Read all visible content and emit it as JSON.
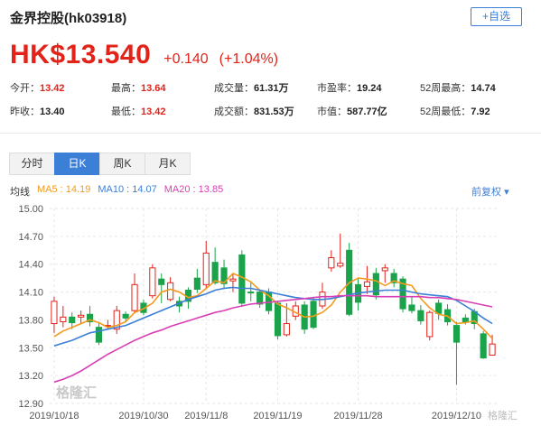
{
  "header": {
    "title": "金界控股(hk03918)",
    "add_button": "+自选"
  },
  "quote": {
    "price": "HK$13.540",
    "change": "+0.140",
    "change_pct": "(+1.04%)",
    "color": "#e2231a"
  },
  "stats": [
    {
      "label": "今开：",
      "value": "13.42",
      "tone": "red"
    },
    {
      "label": "最高：",
      "value": "13.64",
      "tone": "red"
    },
    {
      "label": "成交量：",
      "value": "61.31万",
      "tone": "plain"
    },
    {
      "label": "市盈率：",
      "value": "19.24",
      "tone": "plain"
    },
    {
      "label": "52周最高：",
      "value": "14.74",
      "tone": "plain"
    },
    {
      "label": "昨收：",
      "value": "13.40",
      "tone": "plain"
    },
    {
      "label": "最低：",
      "value": "13.42",
      "tone": "red"
    },
    {
      "label": "成交额：",
      "value": "831.53万",
      "tone": "plain"
    },
    {
      "label": "市值：",
      "value": "587.77亿",
      "tone": "plain"
    },
    {
      "label": "52周最低：",
      "value": "7.92",
      "tone": "plain"
    }
  ],
  "tabs": {
    "minute": "分时",
    "day": "日K",
    "week": "周K",
    "month": "月K",
    "active": "day"
  },
  "legend": {
    "label": "均线",
    "ma5": "MA5 : 14.19",
    "ma10": "MA10 : 14.07",
    "ma20": "MA20 : 13.85",
    "adjust": "前复权"
  },
  "colors": {
    "up": "#e2231a",
    "down": "#1aa34a",
    "accent": "#3c7fd6",
    "ma5": "#f39a1e",
    "ma10": "#3c7fd6",
    "ma20": "#d93fb5"
  },
  "watermark": {
    "main": "格隆汇",
    "corner": "格隆汇"
  },
  "chart_data": {
    "type": "candlestick",
    "ylim": [
      12.9,
      15.0
    ],
    "y_ticks": [
      "15.00",
      "14.70",
      "14.40",
      "14.10",
      "13.80",
      "13.50",
      "13.20",
      "12.90"
    ],
    "x_tick_labels": [
      "2019/10/18",
      "2019/10/30",
      "2019/11/8",
      "2019/11/19",
      "2019/11/28",
      "2019/12/10"
    ],
    "candles": [
      {
        "o": 13.76,
        "c": 14.0,
        "h": 14.05,
        "l": 13.66
      },
      {
        "o": 13.78,
        "c": 13.83,
        "h": 13.95,
        "l": 13.72
      },
      {
        "o": 13.83,
        "c": 13.77,
        "h": 13.88,
        "l": 13.7
      },
      {
        "o": 13.83,
        "c": 13.85,
        "h": 13.9,
        "l": 13.75
      },
      {
        "o": 13.86,
        "c": 13.78,
        "h": 13.95,
        "l": 13.73
      },
      {
        "o": 13.72,
        "c": 13.56,
        "h": 13.78,
        "l": 13.53
      },
      {
        "o": 13.73,
        "c": 13.74,
        "h": 13.8,
        "l": 13.7
      },
      {
        "o": 13.7,
        "c": 13.9,
        "h": 13.95,
        "l": 13.65
      },
      {
        "o": 13.86,
        "c": 13.82,
        "h": 13.89,
        "l": 13.78
      },
      {
        "o": 13.9,
        "c": 14.18,
        "h": 14.3,
        "l": 13.87
      },
      {
        "o": 13.98,
        "c": 13.88,
        "h": 14.02,
        "l": 13.85
      },
      {
        "o": 14.06,
        "c": 14.36,
        "h": 14.4,
        "l": 14.03
      },
      {
        "o": 14.24,
        "c": 14.18,
        "h": 14.3,
        "l": 13.98
      },
      {
        "o": 14.02,
        "c": 14.2,
        "h": 14.26,
        "l": 14.0
      },
      {
        "o": 14.0,
        "c": 13.95,
        "h": 14.05,
        "l": 13.88
      },
      {
        "o": 14.12,
        "c": 14.0,
        "h": 14.15,
        "l": 13.92
      },
      {
        "o": 14.25,
        "c": 14.13,
        "h": 14.35,
        "l": 14.09
      },
      {
        "o": 14.18,
        "c": 14.52,
        "h": 14.65,
        "l": 14.13
      },
      {
        "o": 14.42,
        "c": 14.2,
        "h": 14.58,
        "l": 14.18
      },
      {
        "o": 14.36,
        "c": 14.19,
        "h": 14.45,
        "l": 14.13
      },
      {
        "o": 14.22,
        "c": 14.24,
        "h": 14.3,
        "l": 14.1
      },
      {
        "o": 14.5,
        "c": 13.98,
        "h": 14.55,
        "l": 13.94
      },
      {
        "o": 14.1,
        "c": 14.09,
        "h": 14.2,
        "l": 14.0
      },
      {
        "o": 14.1,
        "c": 13.97,
        "h": 14.12,
        "l": 13.93
      },
      {
        "o": 14.1,
        "c": 13.9,
        "h": 14.14,
        "l": 13.86
      },
      {
        "o": 13.98,
        "c": 13.63,
        "h": 14.0,
        "l": 13.59
      },
      {
        "o": 13.64,
        "c": 13.76,
        "h": 13.98,
        "l": 13.62
      },
      {
        "o": 13.84,
        "c": 13.95,
        "h": 14.0,
        "l": 13.8
      },
      {
        "o": 13.96,
        "c": 13.7,
        "h": 14.0,
        "l": 13.65
      },
      {
        "o": 14.0,
        "c": 13.72,
        "h": 14.05,
        "l": 13.7
      },
      {
        "o": 13.95,
        "c": 14.1,
        "h": 14.2,
        "l": 13.92
      },
      {
        "o": 14.36,
        "c": 14.47,
        "h": 14.55,
        "l": 14.32
      },
      {
        "o": 14.38,
        "c": 14.41,
        "h": 14.73,
        "l": 14.36
      },
      {
        "o": 14.55,
        "c": 13.86,
        "h": 14.63,
        "l": 13.84
      },
      {
        "o": 14.18,
        "c": 13.99,
        "h": 14.25,
        "l": 13.9
      },
      {
        "o": 14.16,
        "c": 14.21,
        "h": 14.38,
        "l": 14.08
      },
      {
        "o": 14.3,
        "c": 14.07,
        "h": 14.36,
        "l": 14.02
      },
      {
        "o": 14.33,
        "c": 14.36,
        "h": 14.4,
        "l": 14.2
      },
      {
        "o": 14.3,
        "c": 14.2,
        "h": 14.35,
        "l": 14.15
      },
      {
        "o": 14.24,
        "c": 13.92,
        "h": 14.27,
        "l": 13.88
      },
      {
        "o": 13.96,
        "c": 13.9,
        "h": 14.05,
        "l": 13.87
      },
      {
        "o": 13.9,
        "c": 13.79,
        "h": 13.96,
        "l": 13.75
      },
      {
        "o": 13.62,
        "c": 13.88,
        "h": 13.9,
        "l": 13.58
      },
      {
        "o": 13.98,
        "c": 13.87,
        "h": 14.02,
        "l": 13.8
      },
      {
        "o": 13.91,
        "c": 13.78,
        "h": 13.97,
        "l": 13.74
      },
      {
        "o": 13.74,
        "c": 13.56,
        "h": 13.78,
        "l": 13.1
      },
      {
        "o": 13.82,
        "c": 13.78,
        "h": 13.86,
        "l": 13.75
      },
      {
        "o": 13.89,
        "c": 13.76,
        "h": 13.92,
        "l": 13.7
      },
      {
        "o": 13.65,
        "c": 13.39,
        "h": 13.68,
        "l": 13.38
      },
      {
        "o": 13.42,
        "c": 13.54,
        "h": 13.64,
        "l": 13.42
      }
    ],
    "series": [
      {
        "name": "MA5",
        "values": [
          13.62,
          13.68,
          13.72,
          13.76,
          13.8,
          13.77,
          13.72,
          13.74,
          13.78,
          13.88,
          13.92,
          13.98,
          14.1,
          14.13,
          14.1,
          14.04,
          14.06,
          14.14,
          14.22,
          14.2,
          14.3,
          14.26,
          14.21,
          14.12,
          14.06,
          13.97,
          13.93,
          13.88,
          13.83,
          13.84,
          13.88,
          13.96,
          14.1,
          14.2,
          14.25,
          14.24,
          14.22,
          14.17,
          14.22,
          14.19,
          14.17,
          14.03,
          13.93,
          13.86,
          13.84,
          13.76,
          13.77,
          13.79,
          13.7,
          13.6
        ]
      },
      {
        "name": "MA10",
        "values": [
          13.52,
          13.55,
          13.58,
          13.62,
          13.66,
          13.68,
          13.7,
          13.72,
          13.74,
          13.78,
          13.82,
          13.86,
          13.9,
          13.94,
          13.98,
          14.02,
          14.05,
          14.08,
          14.12,
          14.14,
          14.15,
          14.14,
          14.14,
          14.12,
          14.1,
          14.08,
          14.06,
          14.04,
          14.03,
          14.02,
          14.02,
          14.03,
          14.05,
          14.07,
          14.09,
          14.1,
          14.11,
          14.12,
          14.12,
          14.12,
          14.1,
          14.08,
          14.07,
          14.06,
          14.05,
          14.01,
          13.95,
          13.89,
          13.82,
          13.76
        ]
      },
      {
        "name": "MA20",
        "values": [
          13.13,
          13.16,
          13.2,
          13.25,
          13.31,
          13.37,
          13.43,
          13.48,
          13.53,
          13.58,
          13.62,
          13.66,
          13.69,
          13.73,
          13.76,
          13.79,
          13.82,
          13.85,
          13.88,
          13.9,
          13.93,
          13.95,
          13.97,
          13.98,
          13.99,
          14.0,
          14.01,
          14.02,
          14.03,
          14.04,
          14.05,
          14.05,
          14.06,
          14.06,
          14.06,
          14.06,
          14.05,
          14.05,
          14.05,
          14.05,
          14.05,
          14.05,
          14.04,
          14.04,
          14.03,
          14.02,
          14.0,
          13.98,
          13.96,
          13.94
        ]
      }
    ]
  }
}
